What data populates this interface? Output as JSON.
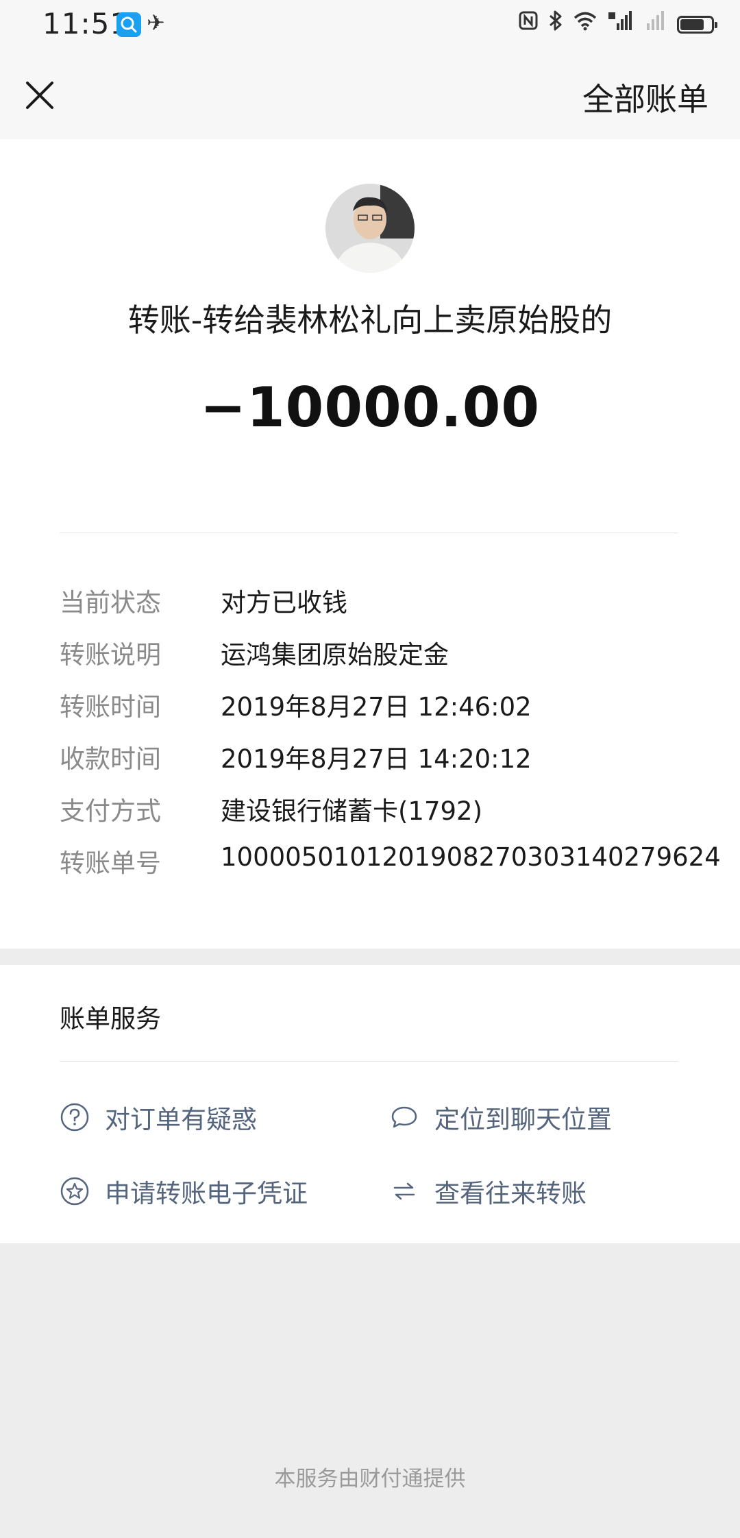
{
  "status_bar": {
    "time": "11:51",
    "icons": [
      "search-app-icon",
      "alipay-icon",
      "nfc-icon",
      "bluetooth-icon",
      "wifi-icon",
      "4g-signal-icon",
      "signal-icon",
      "battery-icon"
    ]
  },
  "header": {
    "close_icon": "close-icon",
    "all_bills_label": "全部账单"
  },
  "transfer": {
    "title": "转账-转给裴林松礼向上卖原始股的",
    "amount": "−10000.00"
  },
  "details": [
    {
      "label": "当前状态",
      "value": "对方已收钱"
    },
    {
      "label": "转账说明",
      "value": "运鸿集团原始股定金"
    },
    {
      "label": "转账时间",
      "value": "2019年8月27日 12:46:02"
    },
    {
      "label": "收款时间",
      "value": "2019年8月27日 14:20:12"
    },
    {
      "label": "支付方式",
      "value": "建设银行储蓄卡(1792)"
    },
    {
      "label": "转账单号",
      "value": "100005010120190827030314027962​4"
    }
  ],
  "services": {
    "title": "账单服务",
    "items": [
      {
        "icon": "question-circle-icon",
        "label": "对订单有疑惑"
      },
      {
        "icon": "chat-bubble-icon",
        "label": "定位到聊天位置"
      },
      {
        "icon": "star-circle-icon",
        "label": "申请转账电子凭证"
      },
      {
        "icon": "transfer-arrows-icon",
        "label": "查看往来转账"
      }
    ]
  },
  "footer": {
    "note": "本服务由财付通提供"
  },
  "colors": {
    "page_background": "#ededed",
    "card_background": "#ffffff",
    "label_gray": "#8a8a8a",
    "service_link": "#55657e"
  }
}
